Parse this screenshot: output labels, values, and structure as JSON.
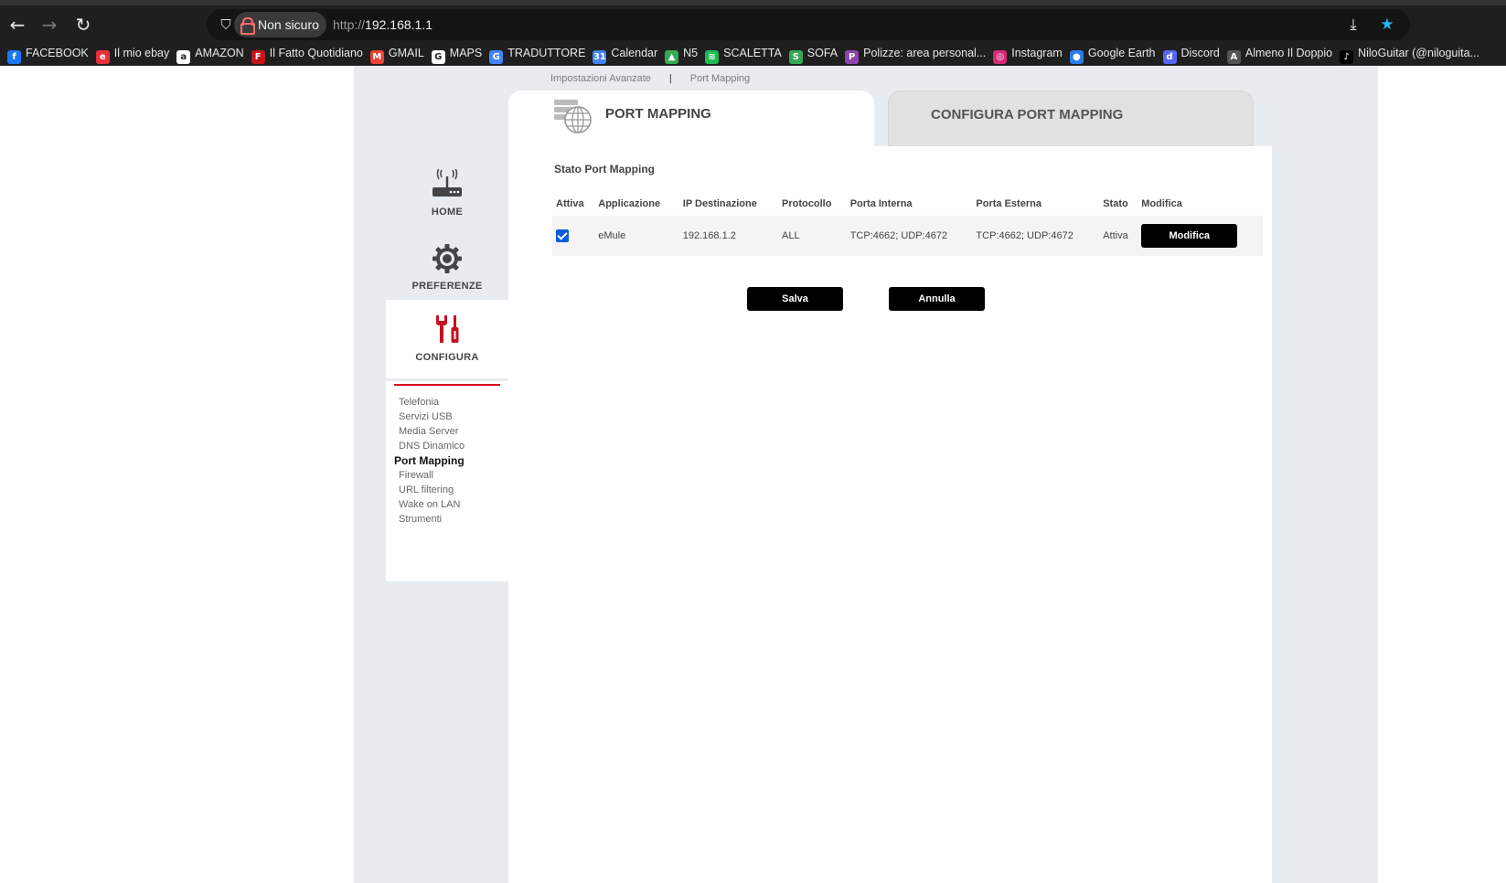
{
  "browser": {
    "security_label": "Non sicuro",
    "url_scheme": "http://",
    "url_host": "192.168.1.1",
    "bookmarks": [
      {
        "label": "FACEBOOK",
        "icon": "facebook-icon",
        "color": "#1877f2",
        "glyph": "f"
      },
      {
        "label": "Il mio ebay",
        "icon": "ebay-icon",
        "color": "#e53238",
        "glyph": "e"
      },
      {
        "label": "AMAZON",
        "icon": "amazon-icon",
        "color": "#ffffff",
        "glyph": "a"
      },
      {
        "label": "Il Fatto Quotidiano",
        "icon": "fatto-quotidiano-icon",
        "color": "#c4161c",
        "glyph": "F"
      },
      {
        "label": "GMAIL",
        "icon": "gmail-icon",
        "color": "#ea4335",
        "glyph": "M"
      },
      {
        "label": "MAPS",
        "icon": "google-icon",
        "color": "#ffffff",
        "glyph": "G"
      },
      {
        "label": "TRADUTTORE",
        "icon": "translate-icon",
        "color": "#4285f4",
        "glyph": "G"
      },
      {
        "label": "Calendar",
        "icon": "calendar-icon",
        "color": "#4285f4",
        "glyph": "31"
      },
      {
        "label": "N5",
        "icon": "drive-icon",
        "color": "#34a853",
        "glyph": "▲"
      },
      {
        "label": "SCALETTA",
        "icon": "spotify-icon",
        "color": "#1db954",
        "glyph": "≋"
      },
      {
        "label": "SOFA",
        "icon": "sofa-icon",
        "color": "#34a853",
        "glyph": "S"
      },
      {
        "label": "Polizze: area personal...",
        "icon": "polizze-icon",
        "color": "#8e44ad",
        "glyph": "P"
      },
      {
        "label": "Instagram",
        "icon": "instagram-icon",
        "color": "#d62976",
        "glyph": "◎"
      },
      {
        "label": "Google Earth",
        "icon": "earth-icon",
        "color": "#2b7de9",
        "glyph": "●"
      },
      {
        "label": "Discord",
        "icon": "discord-icon",
        "color": "#5865f2",
        "glyph": "d"
      },
      {
        "label": "Almeno Il Doppio",
        "icon": "almeno-icon",
        "color": "#555555",
        "glyph": "A"
      },
      {
        "label": "NiloGuitar (@niloguita...",
        "icon": "tiktok-icon",
        "color": "#000000",
        "glyph": "♪"
      }
    ]
  },
  "breadcrumb": {
    "parent": "Impostazioni Avanzate",
    "separator": "|",
    "current": "Port Mapping"
  },
  "sidebar": {
    "home": "HOME",
    "preferenze": "PREFERENZE",
    "configura": "CONFIGURA",
    "submenu": [
      {
        "label": "Telefonia",
        "current": false
      },
      {
        "label": "Servizi USB",
        "current": false
      },
      {
        "label": "Media Server",
        "current": false
      },
      {
        "label": "DNS Dinamico",
        "current": false
      },
      {
        "label": "Port Mapping",
        "current": true
      },
      {
        "label": "Firewall",
        "current": false
      },
      {
        "label": "URL filtering",
        "current": false
      },
      {
        "label": "Wake on LAN",
        "current": false
      },
      {
        "label": "Strumenti",
        "current": false
      }
    ]
  },
  "tabs": {
    "active": "PORT MAPPING",
    "inactive": "CONFIGURA PORT MAPPING"
  },
  "main": {
    "section_title": "Stato Port Mapping",
    "columns": [
      "Attiva",
      "Applicazione",
      "IP Destinazione",
      "Protocollo",
      "Porta Interna",
      "Porta Esterna",
      "Stato",
      "Modifica"
    ],
    "rows": [
      {
        "attiva": true,
        "applicazione": "eMule",
        "ip": "192.168.1.2",
        "protocollo": "ALL",
        "porta_interna": "TCP:4662; UDP:4672",
        "porta_esterna": "TCP:4662; UDP:4672",
        "stato": "Attiva",
        "modifica_label": "Modifica"
      }
    ],
    "save_label": "Salva",
    "cancel_label": "Annulla"
  },
  "colors": {
    "accent_red": "#d6001c",
    "checkbox_blue": "#0b5cd6",
    "frame_bg": "#e8ecef"
  }
}
